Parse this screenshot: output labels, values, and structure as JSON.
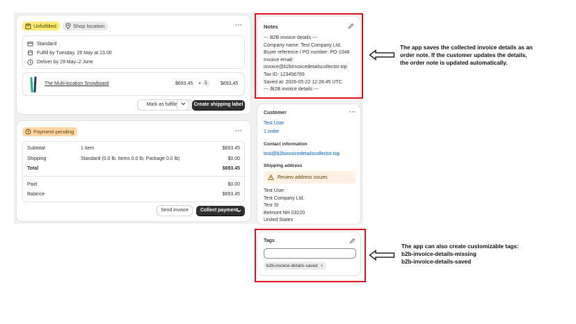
{
  "fulfillment": {
    "status_badge": "Unfulfilled",
    "location_badge": "Shop location",
    "shipping_method": "Standard",
    "fulfill_by": "Fulfill by Tuesday, 26 May at 13.00",
    "deliver_by": "Deliver by 29 May–2 June",
    "product_name": "The Multi-location Snowboard",
    "unit_price": "$693,45",
    "times": "×",
    "quantity": "1",
    "line_total": "$693,45",
    "mark_fulfilled_label": "Mark as fulfilled",
    "create_label_label": "Create shipping label"
  },
  "payment": {
    "status_badge": "Payment pending",
    "rows": [
      {
        "label": "Subtotal",
        "desc": "1 item",
        "amount": "$693.45"
      },
      {
        "label": "Shipping",
        "desc": "Standard (0.0 lb: Items 0.0 lb, Package 0.0 lb)",
        "amount": "$0.00"
      },
      {
        "label": "Total",
        "desc": "",
        "amount": "$693.45"
      }
    ],
    "paid_label": "Paid",
    "paid_amount": "$0.00",
    "balance_label": "Balance",
    "balance_amount": "$693.45",
    "send_invoice_label": "Send invoice",
    "collect_payment_label": "Collect payment"
  },
  "notes": {
    "title": "Notes",
    "lines": [
      "--- B2B invoice details ---",
      "Company name: Test Company Ltd.",
      "Buyer reference / PO number: PO-1048",
      "Invoice email:",
      "invoice@b2binvoicedetailscollector.top",
      "Tax ID: 123456789",
      "Saved at: 2026-05-22 12:28:45 UTC",
      "--- /B2B invoice details ---"
    ]
  },
  "customer": {
    "title": "Customer",
    "name": "Test User",
    "orders": "1 order",
    "contact_title": "Contact information",
    "email": "test@b2binvoicedetailscollector.top",
    "shipping_title": "Shipping address",
    "review_label": "Review address issues",
    "address": [
      "Test User",
      "Test Company Ltd.",
      "Test St",
      "Belmont NH 03220",
      "United States"
    ]
  },
  "tags": {
    "title": "Tags",
    "input_value": "",
    "chip": "b2b-invoice-details-saved",
    "chip_remove": "×"
  },
  "annotations": {
    "notes": [
      "The app saves the collected invoice details as an",
      "order note. If the customer updates the details,",
      "the order note is updated automatically."
    ],
    "tags": [
      "The app can also create customizable tags:",
      "b2b-invoice-details-missing",
      "b2b-invoice-details-saved"
    ]
  },
  "colors": {
    "unfulfilled_badge": "#ffeb78",
    "payment_badge": "#ffd6a4",
    "highlight_border": "#e0101c",
    "link": "#005bd3",
    "primary_button": "#303030"
  }
}
